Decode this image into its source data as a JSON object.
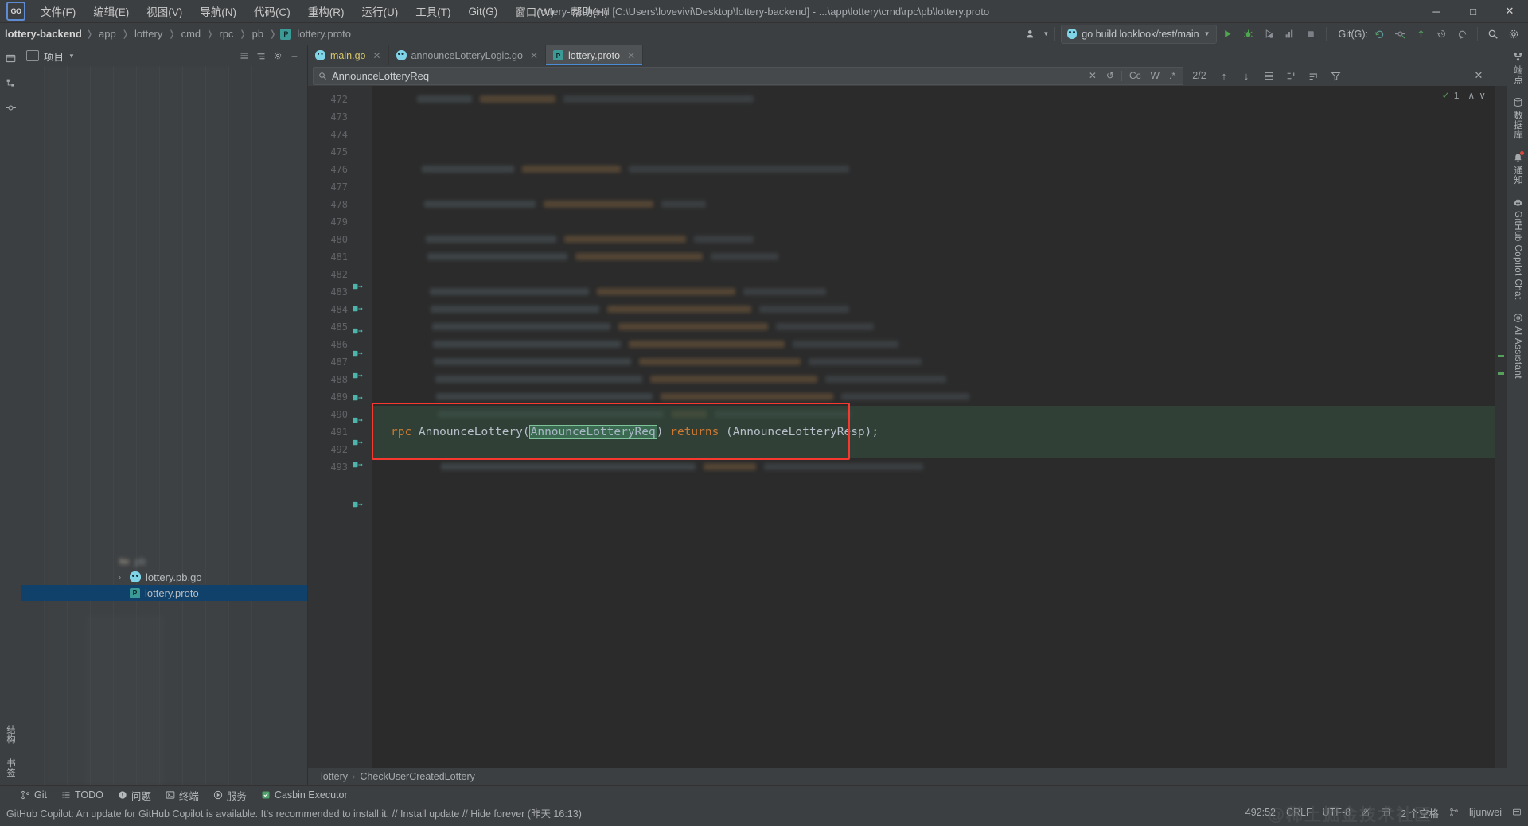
{
  "window": {
    "title": "lottery-backend [C:\\Users\\lovevivi\\Desktop\\lottery-backend] - ...\\app\\lottery\\cmd\\rpc\\pb\\lottery.proto",
    "logo_text": "GO",
    "minimize": "─",
    "maximize": "□",
    "close": "✕"
  },
  "menu": [
    {
      "label": "文件(F)"
    },
    {
      "label": "编辑(E)"
    },
    {
      "label": "视图(V)"
    },
    {
      "label": "导航(N)"
    },
    {
      "label": "代码(C)"
    },
    {
      "label": "重构(R)"
    },
    {
      "label": "运行(U)"
    },
    {
      "label": "工具(T)"
    },
    {
      "label": "Git(G)"
    },
    {
      "label": "窗口(W)"
    },
    {
      "label": "帮助(H)"
    }
  ],
  "breadcrumb": {
    "project": "lottery-backend",
    "segments": [
      "app",
      "lottery",
      "cmd",
      "rpc",
      "pb"
    ],
    "file": "lottery.proto",
    "file_icon": "proto-file-icon",
    "file_icon_letter": "P"
  },
  "toolbar": {
    "account_icon": "user-account-icon",
    "run_config": "go build looklook/test/main",
    "run_config_icon": "go-gopher-icon",
    "run_label": "运行",
    "run_icon": "play-icon",
    "debug_icon": "debug-bug-icon",
    "coverage_icon": "coverage-icon",
    "profile_icon": "profiler-icon",
    "stop_icon": "stop-icon",
    "git_label": "Git(G):",
    "git_update_icon": "git-update-icon",
    "git_commit_icon": "git-commit-icon",
    "git_push_icon": "git-push-icon",
    "git_history_icon": "git-history-icon",
    "git_rollback_icon": "git-rollback-icon",
    "search_icon": "search-icon",
    "settings_icon": "gear-icon"
  },
  "project_panel": {
    "title": "项目",
    "title_icon": "project-view-icon",
    "dropdown_icon": "chevron-down-icon",
    "actions": [
      "expand-all-icon",
      "collapse-all-icon",
      "settings-icon",
      "hide-icon"
    ],
    "tree": [
      {
        "label": "pb",
        "type": "folder",
        "indent": 5,
        "selected": false,
        "arrow": ""
      },
      {
        "label": "lottery.pb.go",
        "type": "go",
        "indent": 6,
        "selected": false,
        "arrow": "›"
      },
      {
        "label": "lottery.proto",
        "type": "proto",
        "indent": 6,
        "selected": true,
        "arrow": ""
      }
    ]
  },
  "left_rail": {
    "top_icons": [
      "project-icon",
      "structure-icon",
      "commit-icon"
    ],
    "bottom_labels": [
      "结构",
      "书签"
    ],
    "bottom_icons": [
      "structure-icon",
      "bookmarks-icon"
    ]
  },
  "editor_tabs": [
    {
      "label": "main.go",
      "icon": "go-file-icon",
      "active": false,
      "close": "✕"
    },
    {
      "label": "announceLotteryLogic.go",
      "icon": "go-file-icon",
      "active": false,
      "close": "✕"
    },
    {
      "label": "lottery.proto",
      "icon": "proto-file-icon",
      "active": true,
      "close": "✕"
    }
  ],
  "find_bar": {
    "search_icon": "search-icon",
    "query": "AnnounceLotteryReq",
    "clear_icon": "✕",
    "regex_history_icon": "↺",
    "match_case": "Cc",
    "words": "W",
    "regex": ".*",
    "match_count": "2/2",
    "prev_icon": "↑",
    "next_icon": "↓",
    "select_all_icon": "select-all-icon",
    "open_in_find_icon": "open-in-find-window-icon",
    "filter_icon": "filter-icon",
    "close_icon": "✕"
  },
  "editor": {
    "first_line": 472,
    "line_count": 22,
    "highlight_line_number": 491,
    "highlight_code_prefix": "rpc AnnounceLottery(",
    "highlight_token": "AnnounceLotteryReq",
    "highlight_code_mid": ") ",
    "highlight_keyword": "returns",
    "highlight_code_suffix": " (AnnounceLotteryResp);",
    "rpc_keyword": "rpc",
    "inspection_count": "1",
    "inspection_ok_icon": "checkmark-icon",
    "up_icon": "∧",
    "down_icon": "∨"
  },
  "editor_breadcrumb": {
    "parts": [
      "lottery",
      "CheckUserCreatedLottery"
    ],
    "separator": "›"
  },
  "right_rail": [
    {
      "label": "端点",
      "icon": "endpoints-icon"
    },
    {
      "label": "数据库",
      "icon": "database-icon"
    },
    {
      "label": "通知",
      "icon": "notifications-bell-icon"
    },
    {
      "label": "GitHub Copilot Chat",
      "icon": "copilot-icon"
    },
    {
      "label": "AI Assistant",
      "icon": "ai-assistant-icon"
    }
  ],
  "tool_windows": [
    {
      "label": "Git",
      "icon": "git-branch-icon"
    },
    {
      "label": "TODO",
      "icon": "todo-list-icon"
    },
    {
      "label": "问题",
      "icon": "problems-icon"
    },
    {
      "label": "终端",
      "icon": "terminal-icon"
    },
    {
      "label": "服务",
      "icon": "services-run-icon"
    },
    {
      "label": "Casbin Executor",
      "icon": "casbin-icon"
    }
  ],
  "status_bar": {
    "message": "GitHub Copilot: An update for GitHub Copilot is available. It's recommended to install it. // Install update // Hide forever (昨天 16:13)",
    "caret_position": "492:52",
    "line_separator": "CRLF",
    "encoding": "UTF-8",
    "indent": "2 个空格",
    "branch": "lijunwei",
    "read_only_icon": "lock-open-icon",
    "indent_icon": "indent-icon",
    "branch_icon": "git-branch-icon",
    "ide_icon": "ide-status-icon",
    "watermark": "@稀土掘金技术社区"
  },
  "colors": {
    "background": "#3c3f41",
    "editor_background": "#2b2b2b",
    "accent_blue": "#4b8dd4",
    "selection_blue": "#10416b",
    "highlight_red": "#f6382f",
    "keyword_orange": "#cc7832",
    "match_green": "#3a6b50",
    "run_green": "#4ea64e"
  }
}
